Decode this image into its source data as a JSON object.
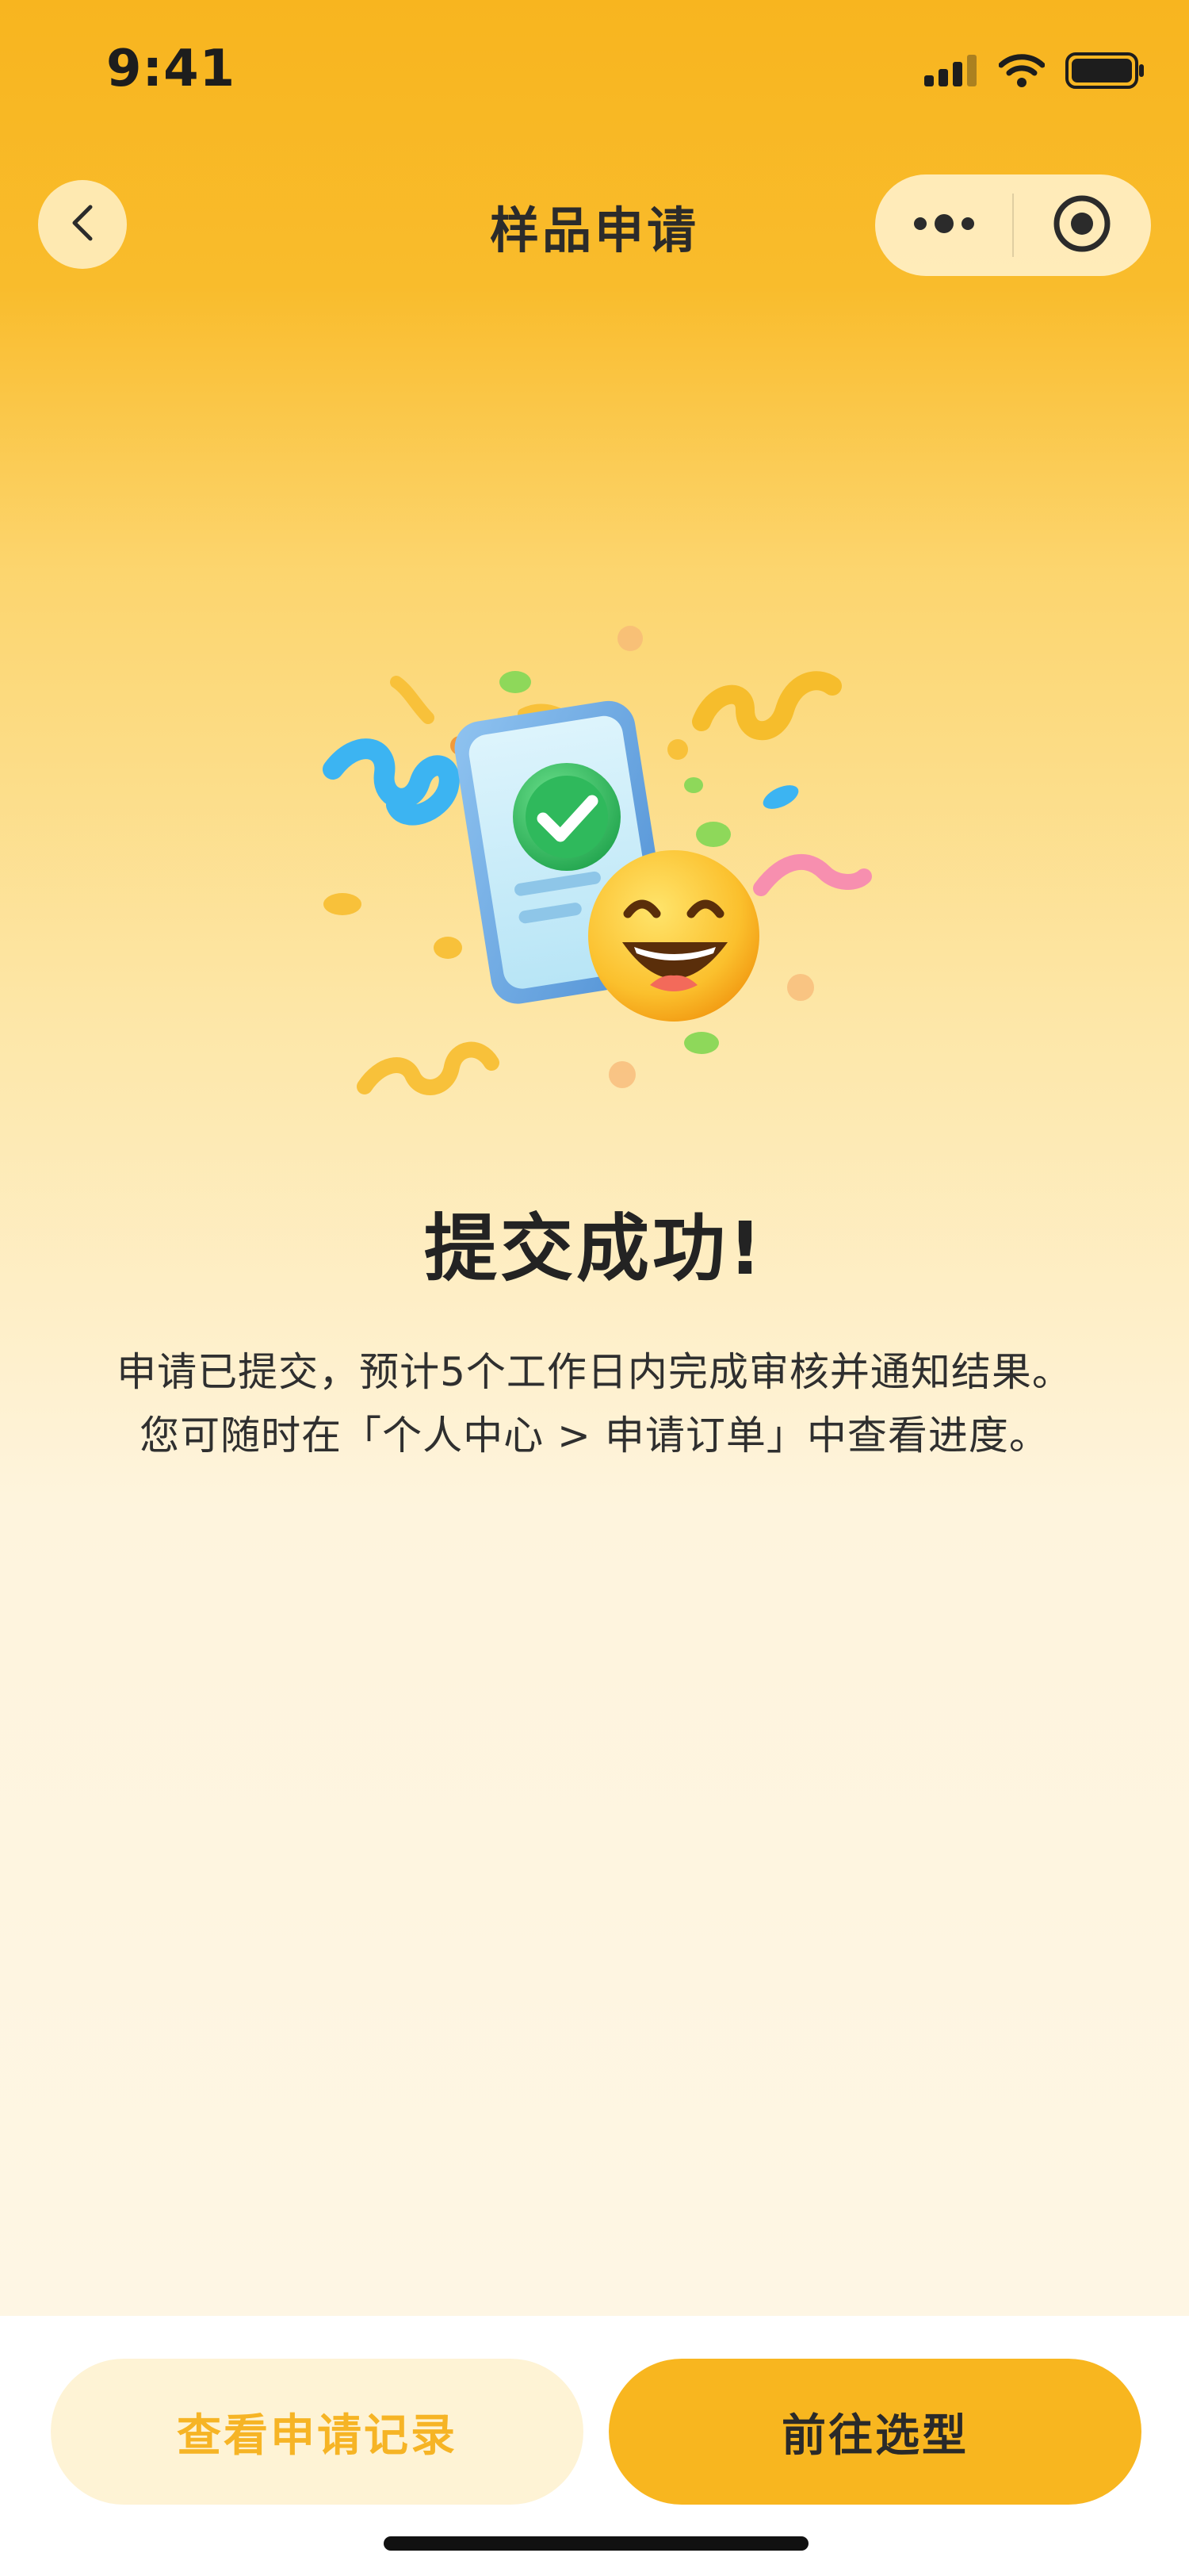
{
  "status_bar": {
    "time": "9:41"
  },
  "nav": {
    "title": "样品申请"
  },
  "result": {
    "title": "提交成功!",
    "description_line1": "申请已提交，预计5个工作日内完成审核并通知结果。",
    "description_line2": "您可随时在「个人中心 > 申请订单」中查看进度。"
  },
  "actions": {
    "secondary_label": "查看申请记录",
    "primary_label": "前往选型"
  },
  "colors": {
    "accent": "#F8B61F",
    "secondary_bg": "#FEF3D5",
    "secondary_text": "#F6B425",
    "success_green": "#3CC26B"
  },
  "icons": {
    "back": "chevron-left-icon",
    "more": "more-dots-icon",
    "close_miniprogram": "target-circle-icon",
    "illustration": "success-phone-emoji-illustration"
  }
}
